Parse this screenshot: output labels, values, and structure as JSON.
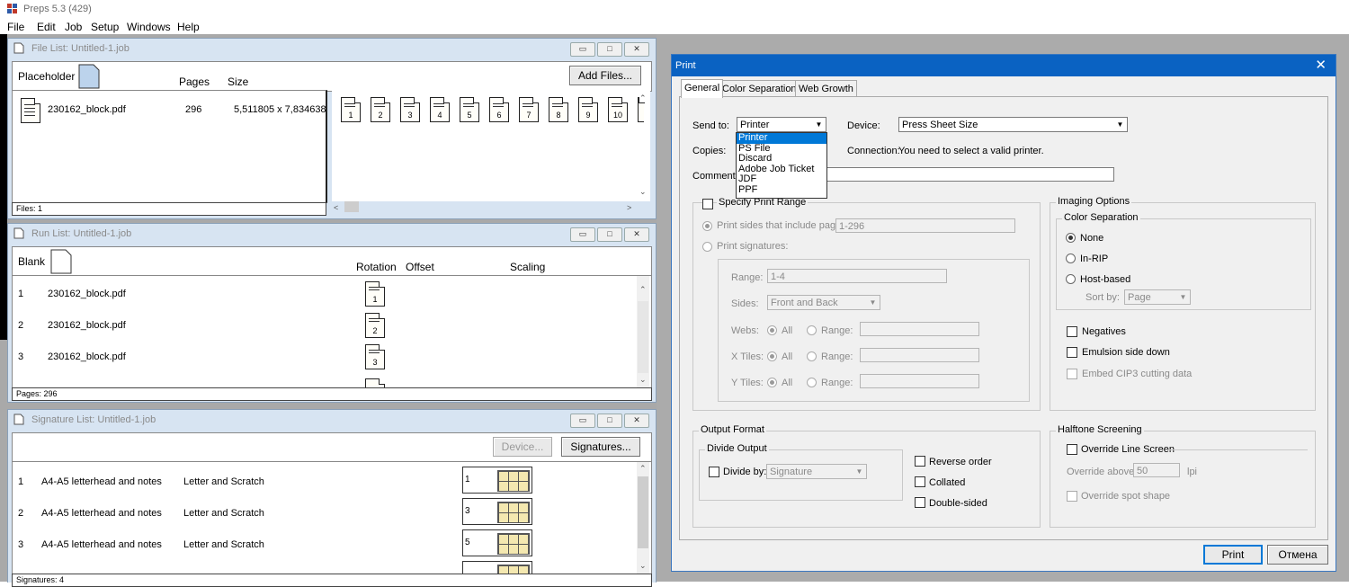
{
  "app": {
    "title": "Preps 5.3 (429)"
  },
  "menu": [
    "File",
    "Edit",
    "Job",
    "Setup",
    "Windows",
    "Help"
  ],
  "window_buttons": {
    "minimize": "▭",
    "maximize": "□",
    "close": "✕"
  },
  "file_list": {
    "title": "File List:  Untitled-1.job",
    "col_placeholder": "Placeholder",
    "col_pages": "Pages",
    "col_size": "Size",
    "add_files": "Add Files...",
    "file": {
      "name": "230162_block.pdf",
      "pages": "296",
      "size": "5,511805 x 7,834638"
    },
    "thumbs": [
      "1",
      "2",
      "3",
      "4",
      "5",
      "6",
      "7",
      "8",
      "9",
      "10"
    ],
    "status": "Files: 1"
  },
  "run_list": {
    "title": "Run List:  Untitled-1.job",
    "col_blank": "Blank",
    "col_rotation": "Rotation",
    "col_offset": "Offset",
    "col_scaling": "Scaling",
    "rows": [
      {
        "n": "1",
        "name": "230162_block.pdf",
        "page": "1"
      },
      {
        "n": "2",
        "name": "230162_block.pdf",
        "page": "2"
      },
      {
        "n": "3",
        "name": "230162_block.pdf",
        "page": "3"
      }
    ],
    "status": "Pages: 296"
  },
  "signature_list": {
    "title": "Signature List:  Untitled-1.job",
    "device_btn": "Device...",
    "signatures_btn": "Signatures...",
    "rows": [
      {
        "n": "1",
        "name": "A4-A5 letterhead and notes",
        "stock": "Letter and Scratch",
        "page": "1"
      },
      {
        "n": "2",
        "name": "A4-A5 letterhead and notes",
        "stock": "Letter and Scratch",
        "page": "3"
      },
      {
        "n": "3",
        "name": "A4-A5 letterhead and notes",
        "stock": "Letter and Scratch",
        "page": "5"
      }
    ],
    "status": "Signatures: 4"
  },
  "print_dialog": {
    "title": "Print",
    "close": "✕",
    "tabs": [
      "General",
      "Color Separations",
      "Web Growth"
    ],
    "send_to_label": "Send to:",
    "send_to_value": "Printer",
    "send_to_options": [
      "Printer",
      "PS File",
      "Discard",
      "Adobe Job Ticket",
      "JDF",
      "PPF"
    ],
    "device_label": "Device:",
    "device_value": "Press Sheet Size",
    "copies_label": "Copies:",
    "connection_label": "Connection:",
    "connection_value": "You need to select a valid printer.",
    "comment_label": "Comment:",
    "print_range": {
      "label": "Specify Print Range",
      "sides_label": "Print sides that include pages:",
      "sides_value": "1-296",
      "signatures_label": "Print signatures:",
      "range_label": "Range:",
      "range_value": "1-4",
      "sides2_label": "Sides:",
      "sides2_value": "Front and Back",
      "webs_label": "Webs:",
      "xtiles_label": "X Tiles:",
      "ytiles_label": "Y Tiles:",
      "all_label": "All",
      "range_opt_label": "Range:"
    },
    "imaging": {
      "label": "Imaging Options",
      "color_sep_label": "Color Separation",
      "none": "None",
      "inrip": "In-RIP",
      "hostbased": "Host-based",
      "sortby_label": "Sort by:",
      "sortby_value": "Page",
      "negatives": "Negatives",
      "emulsion": "Emulsion side down",
      "embed": "Embed CIP3 cutting data"
    },
    "output": {
      "label": "Output Format",
      "divide_output": "Divide Output",
      "divide_by": "Divide by:",
      "divide_by_value": "Signature",
      "reverse": "Reverse order",
      "collated": "Collated",
      "double": "Double-sided"
    },
    "halftone": {
      "label": "Halftone Screening",
      "override_line": "Override Line Screen",
      "override_above": "Override above:",
      "override_value": "50",
      "lpi": "lpi",
      "override_spot": "Override spot shape"
    },
    "print_btn": "Print",
    "cancel_btn": "Отмена"
  },
  "colors": {
    "dialog_title": "#0a62c2",
    "mdi_frame": "#d7e4f2",
    "selection": "#0078d7"
  }
}
